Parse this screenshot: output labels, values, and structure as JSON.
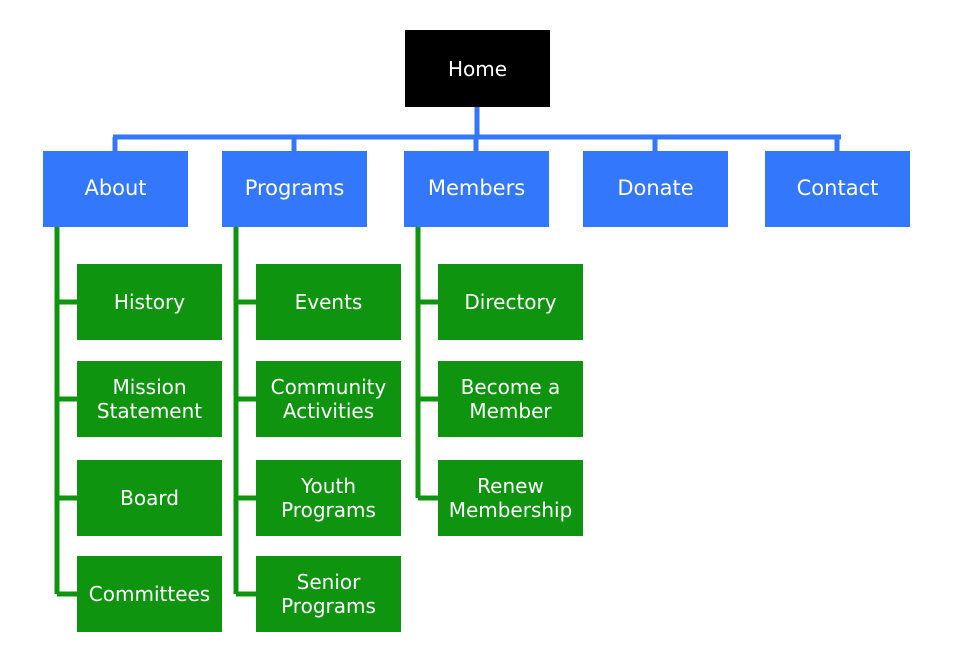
{
  "colors": {
    "root": "#000000",
    "section": "#3377fd",
    "page": "#0f940f"
  },
  "root": {
    "label": "Home"
  },
  "sections": [
    {
      "label": "About",
      "children": [
        "History",
        "Mission Statement",
        "Board",
        "Committees"
      ]
    },
    {
      "label": "Programs",
      "children": [
        "Events",
        "Community Activities",
        "Youth Programs",
        "Senior Programs"
      ]
    },
    {
      "label": "Members",
      "children": [
        "Directory",
        "Become a Member",
        "Renew Membership"
      ]
    },
    {
      "label": "Donate",
      "children": []
    },
    {
      "label": "Contact",
      "children": []
    }
  ]
}
